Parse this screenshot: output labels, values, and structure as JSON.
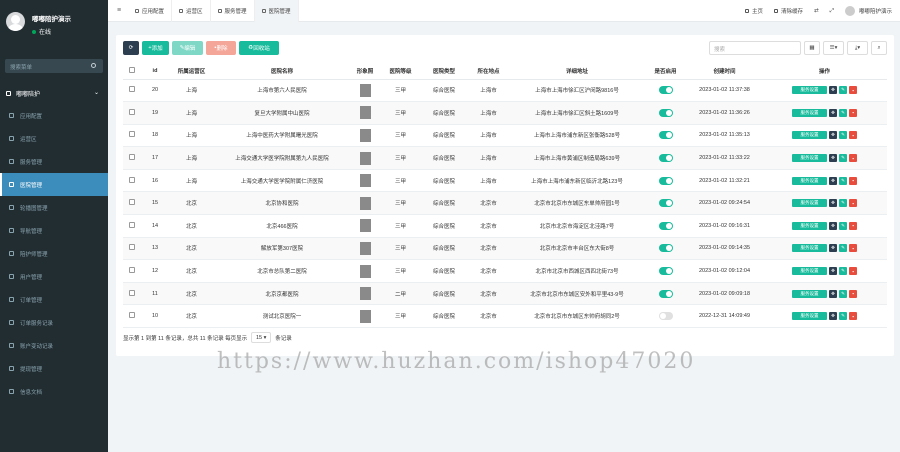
{
  "user": {
    "name": "嘟嘟陪护演示",
    "status": "在线"
  },
  "sidebar": {
    "search_placeholder": "搜索菜单",
    "header": "嘟嘟陪护",
    "items": [
      {
        "label": "应用配置"
      },
      {
        "label": "运营区"
      },
      {
        "label": "服务管理"
      },
      {
        "label": "医院管理"
      },
      {
        "label": "轮播图管理"
      },
      {
        "label": "导航管理"
      },
      {
        "label": "陪护师管理"
      },
      {
        "label": "用户管理"
      },
      {
        "label": "订单管理"
      },
      {
        "label": "订单服务记录"
      },
      {
        "label": "账户变动记录"
      },
      {
        "label": "提现管理"
      },
      {
        "label": "信息文档"
      }
    ]
  },
  "topbar": {
    "tabs": [
      {
        "label": "应用配置"
      },
      {
        "label": "运营区"
      },
      {
        "label": "服务管理"
      },
      {
        "label": "医院管理"
      }
    ],
    "home": "主页",
    "clear_cache": "清除缓存",
    "user_name": "嘟嘟陪护演示"
  },
  "toolbar": {
    "add": "添加",
    "edit": "编辑",
    "delete": "删除",
    "recycle": "回收站",
    "search_placeholder": "搜索"
  },
  "table": {
    "headers": [
      "id",
      "所属运营区",
      "医院名称",
      "形象照",
      "医院等级",
      "医院类型",
      "所在地点",
      "详细地址",
      "是否启用",
      "创建时间",
      "操作"
    ],
    "service_button": "服务设置",
    "rows": [
      {
        "id": "20",
        "region": "上海",
        "name": "上海市第六人民医院",
        "level": "三甲",
        "type": "综合医院",
        "city": "上海市",
        "address": "上海市上海市徐汇区沪闵路9816号",
        "enabled": true,
        "created": "2023-01-02 11:37:38"
      },
      {
        "id": "19",
        "region": "上海",
        "name": "复旦大学附属中山医院",
        "level": "三甲",
        "type": "综合医院",
        "city": "上海市",
        "address": "上海市上海市徐汇区斜土路1609号",
        "enabled": true,
        "created": "2023-01-02 11:36:26"
      },
      {
        "id": "18",
        "region": "上海",
        "name": "上海中医药大学附属曙光医院",
        "level": "三甲",
        "type": "综合医院",
        "city": "上海市",
        "address": "上海市上海市浦东新区张衡路528号",
        "enabled": true,
        "created": "2023-01-02 11:35:13"
      },
      {
        "id": "17",
        "region": "上海",
        "name": "上海交通大学医学院附属第九人民医院",
        "level": "三甲",
        "type": "综合医院",
        "city": "上海市",
        "address": "上海市上海市黄浦区制造局路639号",
        "enabled": true,
        "created": "2023-01-02 11:33:22"
      },
      {
        "id": "16",
        "region": "上海",
        "name": "上海交通大学医学院附属仁济医院",
        "level": "三甲",
        "type": "综合医院",
        "city": "上海市",
        "address": "上海市上海市浦东新区临沂北路123号",
        "enabled": true,
        "created": "2023-01-02 11:32:21"
      },
      {
        "id": "15",
        "region": "北京",
        "name": "北京协和医院",
        "level": "三甲",
        "type": "综合医院",
        "city": "北京市",
        "address": "北京市北京市东城区东单帅府园1号",
        "enabled": true,
        "created": "2023-01-02 09:24:54"
      },
      {
        "id": "14",
        "region": "北京",
        "name": "北京466医院",
        "level": "三甲",
        "type": "综合医院",
        "city": "北京市",
        "address": "北京市北京市海淀区北洼路7号",
        "enabled": true,
        "created": "2023-01-02 09:16:31"
      },
      {
        "id": "13",
        "region": "北京",
        "name": "解放军第307医院",
        "level": "三甲",
        "type": "综合医院",
        "city": "北京市",
        "address": "北京市北京市丰台区东大街8号",
        "enabled": true,
        "created": "2023-01-02 09:14:35"
      },
      {
        "id": "12",
        "region": "北京",
        "name": "北京市总队第二医院",
        "level": "三甲",
        "type": "综合医院",
        "city": "北京市",
        "address": "北京市北京市西城区西四北街73号",
        "enabled": true,
        "created": "2023-01-02 09:12:04"
      },
      {
        "id": "11",
        "region": "北京",
        "name": "北京京都医院",
        "level": "二甲",
        "type": "综合医院",
        "city": "北京市",
        "address": "北京市北京市东城区安外和平里43-9号",
        "enabled": true,
        "created": "2023-01-02 09:09:18"
      },
      {
        "id": "10",
        "region": "北京",
        "name": "测试北京医院一",
        "level": "三甲",
        "type": "综合医院",
        "city": "北京市",
        "address": "北京市北京市东城区东帅府胡同2号",
        "enabled": false,
        "created": "2022-12-31 14:09:49"
      }
    ]
  },
  "footer": {
    "summary": "显示第 1 到第 11 条记录，总共 11 条记录 每页显示",
    "page_size": "15",
    "suffix": "条记录"
  },
  "watermark": "https://www.huzhan.com/ishop47020"
}
